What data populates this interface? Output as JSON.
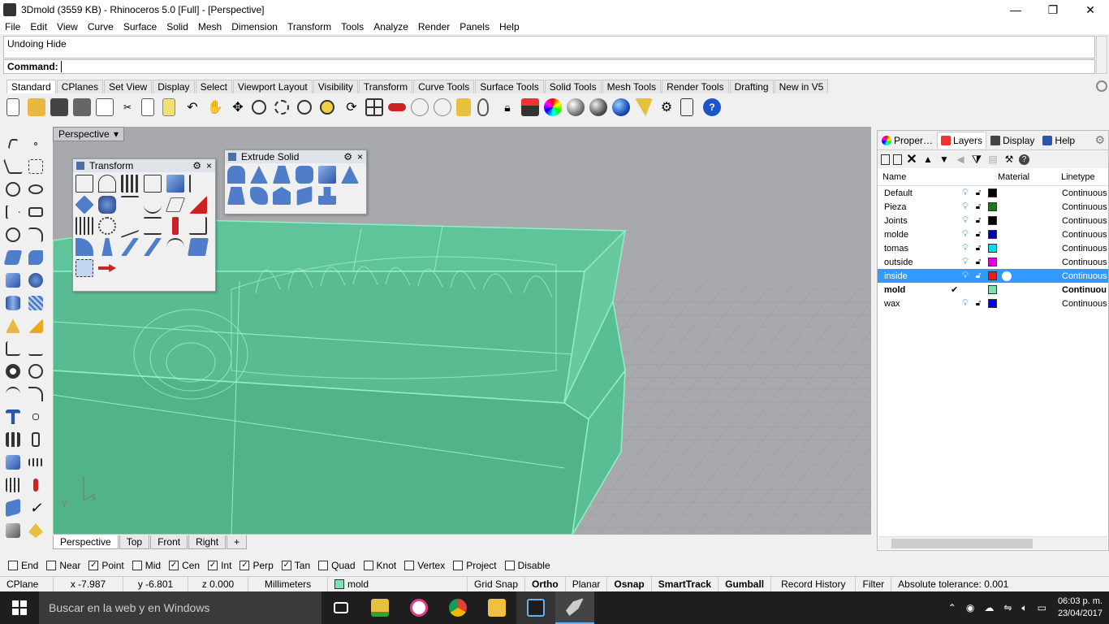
{
  "window": {
    "title": "3Dmold (3559 KB) - Rhinoceros 5.0 [Full] - [Perspective]",
    "minimize": "—",
    "restore": "❐",
    "close": "✕"
  },
  "menu": [
    "File",
    "Edit",
    "View",
    "Curve",
    "Surface",
    "Solid",
    "Mesh",
    "Dimension",
    "Transform",
    "Tools",
    "Analyze",
    "Render",
    "Panels",
    "Help"
  ],
  "command": {
    "history": "Undoing Hide",
    "prompt": "Command:",
    "value": ""
  },
  "toolbar_tabs": [
    "Standard",
    "CPlanes",
    "Set View",
    "Display",
    "Select",
    "Viewport Layout",
    "Visibility",
    "Transform",
    "Curve Tools",
    "Surface Tools",
    "Solid Tools",
    "Mesh Tools",
    "Render Tools",
    "Drafting",
    "New in V5"
  ],
  "toolbar_icons": [
    "new-icon",
    "open-icon",
    "save-icon",
    "print-icon",
    "import-icon",
    "cut-icon",
    "copy-icon",
    "paste-icon",
    "undo-icon",
    "pan-icon",
    "rotate-view-icon",
    "zoom-icon",
    "zoom-window-icon",
    "zoom-extents-icon",
    "zoom-selected-icon",
    "rotate-icon",
    "four-views-icon",
    "car-icon",
    "hide-icon",
    "show-icon",
    "point-icon",
    "light-icon",
    "lock-icon",
    "layer-icon",
    "color-wheel-icon",
    "shade-icon",
    "rendered-icon",
    "render-icon",
    "snapshot-icon",
    "options-icon",
    "properties-icon",
    "help-icon"
  ],
  "viewport": {
    "name": "Perspective",
    "dropdown": "▾",
    "axis_x": "x",
    "axis_y": "y"
  },
  "float_transform": {
    "title": "Transform",
    "gear": "⚙",
    "close": "×"
  },
  "float_extrude": {
    "title": "Extrude Solid",
    "gear": "⚙",
    "close": "×"
  },
  "viewport_tabs": [
    "Perspective",
    "Top",
    "Front",
    "Right",
    "+"
  ],
  "panel": {
    "tabs": [
      "Proper…",
      "Layers",
      "Display",
      "Help"
    ],
    "headers": {
      "name": "Name",
      "material": "Material",
      "linetype": "Linetype"
    },
    "layers": [
      {
        "name": "Default",
        "color": "#000000",
        "linetype": "Continuous",
        "current": false,
        "selected": false
      },
      {
        "name": "Pieza",
        "color": "#1a7a1a",
        "linetype": "Continuous",
        "current": false,
        "selected": false
      },
      {
        "name": "Joints",
        "color": "#000000",
        "linetype": "Continuous",
        "current": false,
        "selected": false
      },
      {
        "name": "molde",
        "color": "#0000a0",
        "linetype": "Continuous",
        "current": false,
        "selected": false
      },
      {
        "name": "tomas",
        "color": "#00e0e0",
        "linetype": "Continuous",
        "current": false,
        "selected": false
      },
      {
        "name": "outside",
        "color": "#e000e0",
        "linetype": "Continuous",
        "current": false,
        "selected": false
      },
      {
        "name": "inside",
        "color": "#e02020",
        "linetype": "Continuous",
        "current": false,
        "selected": true
      },
      {
        "name": "mold",
        "color": "#7fe0b0",
        "linetype": "Continuou",
        "current": true,
        "selected": false
      },
      {
        "name": "wax",
        "color": "#0000e0",
        "linetype": "Continuous",
        "current": false,
        "selected": false
      }
    ],
    "current_mark": "✔"
  },
  "osnaps": [
    {
      "label": "End",
      "checked": false
    },
    {
      "label": "Near",
      "checked": false
    },
    {
      "label": "Point",
      "checked": true
    },
    {
      "label": "Mid",
      "checked": false
    },
    {
      "label": "Cen",
      "checked": true
    },
    {
      "label": "Int",
      "checked": true
    },
    {
      "label": "Perp",
      "checked": true
    },
    {
      "label": "Tan",
      "checked": true
    },
    {
      "label": "Quad",
      "checked": false
    },
    {
      "label": "Knot",
      "checked": false
    },
    {
      "label": "Vertex",
      "checked": false
    },
    {
      "label": "Project",
      "checked": false
    },
    {
      "label": "Disable",
      "checked": false
    }
  ],
  "status": {
    "cplane": "CPlane",
    "x": "x -7.987",
    "y": "y -6.801",
    "z": "z 0.000",
    "units": "Millimeters",
    "layer": "mold",
    "grid_snap": "Grid Snap",
    "ortho": "Ortho",
    "planar": "Planar",
    "osnap": "Osnap",
    "smarttrack": "SmartTrack",
    "gumball": "Gumball",
    "record_history": "Record History",
    "filter": "Filter",
    "tolerance": "Absolute tolerance: 0.001"
  },
  "taskbar": {
    "search": "Buscar en la web y en Windows",
    "time": "06:03 p. m.",
    "date": "23/04/2017"
  },
  "colors": {
    "mold": "#5fc49a",
    "edge": "#8ff0c4",
    "grid": "#8f9296",
    "selected": "#3399ff"
  }
}
